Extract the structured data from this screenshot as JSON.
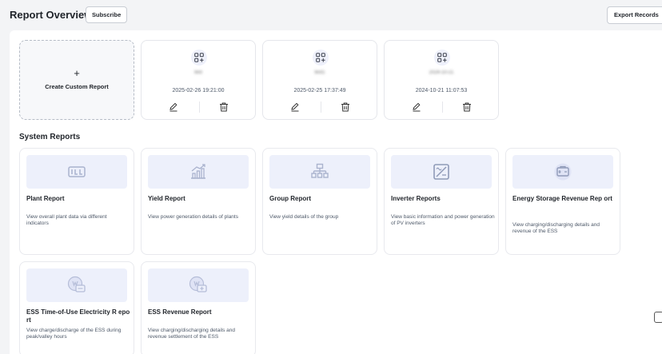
{
  "header": {
    "title": "Report Overview",
    "subscribe_label": "Subscribe",
    "export_label": "Export Records"
  },
  "create": {
    "plus": "+",
    "label": "Create Custom Report"
  },
  "custom_reports": [
    {
      "name": "test",
      "date": "2025-02-26 19:21:00"
    },
    {
      "name": "test1",
      "date": "2025-02-25 17:37:49"
    },
    {
      "name": "2024-10-21",
      "date": "2024-10-21 11:07:53"
    }
  ],
  "section": {
    "title": "System Reports"
  },
  "system_reports": [
    {
      "title": "Plant Report",
      "desc": "View overall plant data via different indicators",
      "icon": "plant-icon"
    },
    {
      "title": "Yield Report",
      "desc": "View power generation details of plants",
      "icon": "yield-chart-icon"
    },
    {
      "title": "Group Report",
      "desc": "View yield details of the group",
      "icon": "group-hierarchy-icon"
    },
    {
      "title": "Inverter Reports",
      "desc": "View basic information and power generation of PV inverters",
      "icon": "inverter-icon"
    },
    {
      "title": "Energy Storage Revenue Rep ort",
      "desc": "View charging/discharging details and revenue of the ESS",
      "icon": "battery-icon"
    },
    {
      "title": "ESS Time-of-Use Electricity R eport",
      "desc": "View charge/discharge of the ESS during peak/valley hours",
      "icon": "ess-tou-icon"
    },
    {
      "title": "ESS Revenue Report",
      "desc": "View charging/discharging details and revenue settlement of the ESS",
      "icon": "ess-revenue-icon"
    }
  ]
}
